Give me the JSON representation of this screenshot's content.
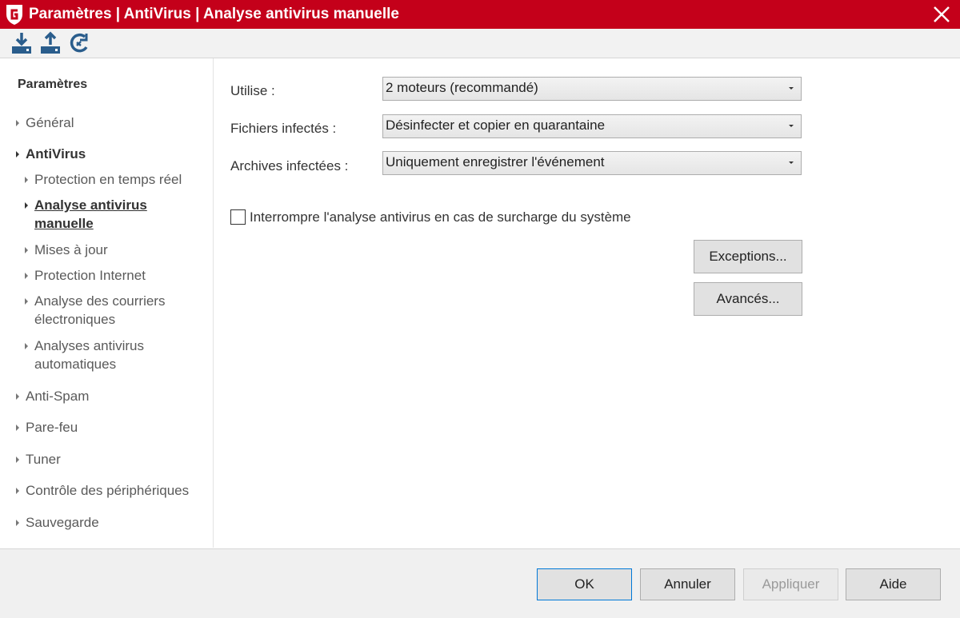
{
  "window": {
    "title": "Paramètres | AntiVirus | Analyse antivirus manuelle",
    "logo_icon": "g-data-logo-icon",
    "close_icon": "close-icon",
    "accent_color": "#c4001a"
  },
  "toolbar": {
    "buttons": [
      {
        "icon": "import-settings-icon"
      },
      {
        "icon": "export-settings-icon"
      },
      {
        "icon": "reset-settings-icon"
      }
    ]
  },
  "sidebar": {
    "heading": "Paramètres",
    "items": [
      {
        "label": "Général"
      },
      {
        "label": "AntiVirus"
      },
      {
        "label": "Protection en temps réel"
      },
      {
        "label": "Analyse antivirus manuelle"
      },
      {
        "label": "Mises à jour"
      },
      {
        "label": "Protection Internet"
      },
      {
        "label": "Analyse des courriers électroniques"
      },
      {
        "label": "Analyses antivirus automatiques"
      },
      {
        "label": "Anti-Spam"
      },
      {
        "label": "Pare-feu"
      },
      {
        "label": "Tuner"
      },
      {
        "label": "Contrôle des périphériques"
      },
      {
        "label": "Sauvegarde"
      }
    ]
  },
  "form": {
    "engines": {
      "label": "Utilise :",
      "value": "2 moteurs (recommandé)"
    },
    "infected_files": {
      "label": "Fichiers infectés :",
      "value": "Désinfecter et copier en quarantaine"
    },
    "infected_archives": {
      "label": "Archives infectées :",
      "value": "Uniquement enregistrer l'événement"
    },
    "interrupt_checkbox": {
      "label": "Interrompre l'analyse antivirus en cas de surcharge du système",
      "checked": false
    },
    "exceptions_button": "Exceptions...",
    "advanced_button": "Avancés..."
  },
  "footer": {
    "ok": "OK",
    "cancel": "Annuler",
    "apply": "Appliquer",
    "help": "Aide"
  }
}
